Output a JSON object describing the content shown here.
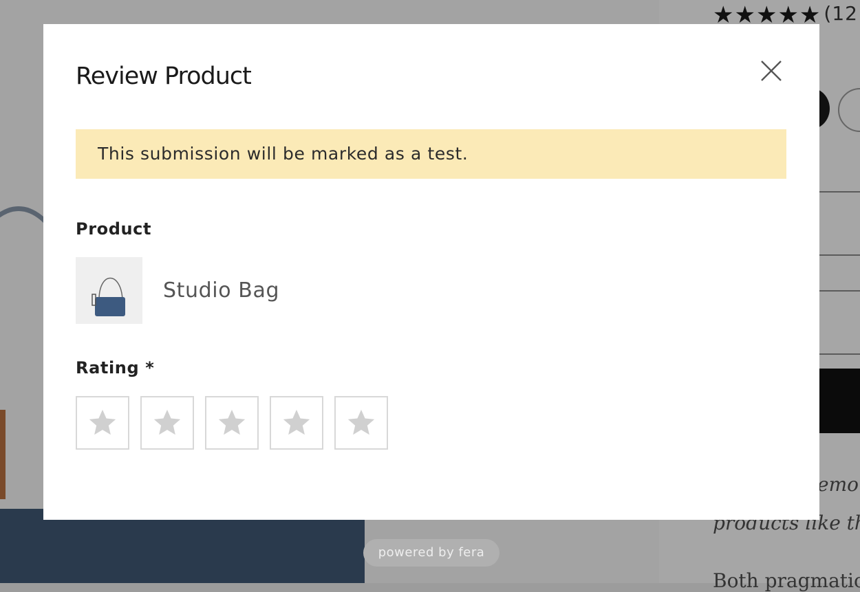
{
  "modal": {
    "title": "Review Product",
    "close_icon": "close-icon",
    "test_notice": "This submission will be marked as a test.",
    "product_label": "Product",
    "product": {
      "name": "Studio Bag",
      "thumbnail_icon": "bag-thumbnail"
    },
    "rating_label": "Rating *",
    "rating": {
      "max": 5,
      "selected": 0,
      "star_icon": "star-icon"
    }
  },
  "background": {
    "review_count": "(12",
    "text_line_1": "emor",
    "text_line_2": "products like th",
    "text_line_3": "Both pragmatic",
    "rating_stars": 4.5
  },
  "footer": {
    "powered_by": "powered by fera"
  },
  "colors": {
    "banner_bg": "#fbeab7",
    "star_gray": "#d0d0d0",
    "overlay": "#9c9c9c"
  }
}
